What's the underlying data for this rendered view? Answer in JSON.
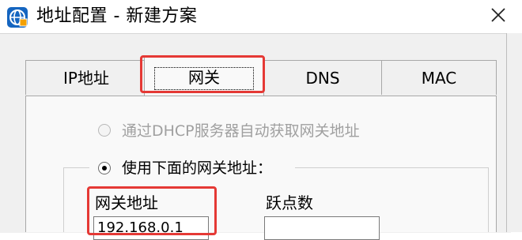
{
  "window": {
    "title": "地址配置 - 新建方案",
    "accent_color": "#1565c0",
    "highlight_color": "#e53935"
  },
  "icons": {
    "app": "network-globe-icon",
    "close": "close-icon"
  },
  "tabs": [
    {
      "label": "IP地址",
      "active": false
    },
    {
      "label": "网关",
      "active": true
    },
    {
      "label": "DNS",
      "active": false
    },
    {
      "label": "MAC",
      "active": false
    }
  ],
  "gateway": {
    "option_dhcp_label": "通过DHCP服务器自动获取网关地址",
    "option_dhcp_selected": false,
    "option_dhcp_enabled": false,
    "option_manual_label": "使用下面的网关地址：",
    "option_manual_selected": true,
    "address_label": "网关地址",
    "address_value": "192.168.0.1",
    "metric_label": "跃点数",
    "metric_value": ""
  }
}
